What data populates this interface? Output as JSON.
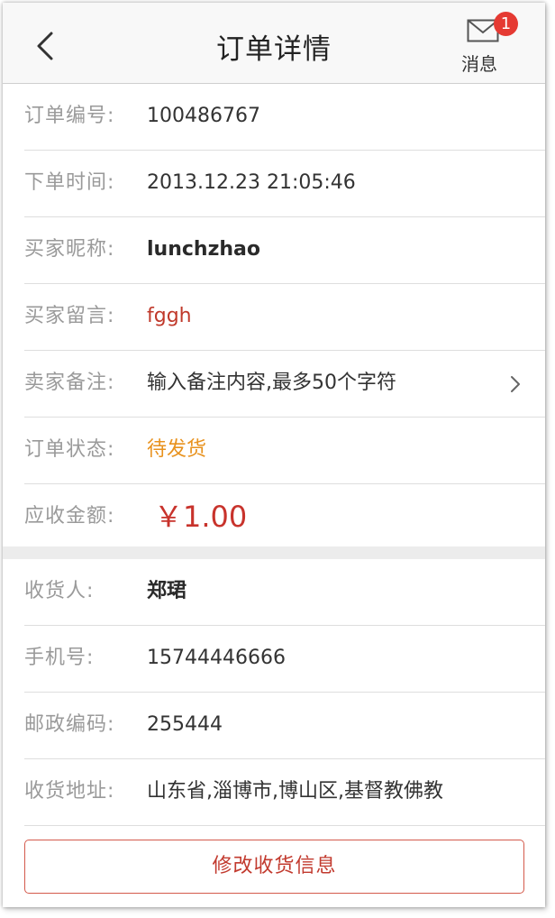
{
  "header": {
    "title": "订单详情",
    "messages_label": "消息",
    "messages_badge": "1"
  },
  "order": {
    "rows": [
      {
        "label": "订单编号:",
        "value": "100486767"
      },
      {
        "label": "下单时间:",
        "value": "2013.12.23 21:05:46"
      },
      {
        "label": "买家昵称:",
        "value": "lunchzhao"
      },
      {
        "label": "买家留言:",
        "value": "fggh"
      },
      {
        "label": "卖家备注:",
        "value": "输入备注内容,最多50个字符"
      },
      {
        "label": "订单状态:",
        "value": "待发货"
      },
      {
        "label": "应收金额:",
        "value": "￥1.00"
      }
    ]
  },
  "shipping": {
    "rows": [
      {
        "label": "收货人:",
        "value": "郑珺"
      },
      {
        "label": "手机号:",
        "value": "15744446666"
      },
      {
        "label": "邮政编码:",
        "value": "255444"
      },
      {
        "label": "收货地址:",
        "value": "山东省,淄博市,博山区,基督教佛教"
      }
    ]
  },
  "actions": {
    "edit_address_label": "修改收货信息"
  },
  "colors": {
    "accent_red": "#c23a2e",
    "status_orange": "#e8921e",
    "badge_red": "#e53a33"
  },
  "icons": {
    "back": "chevron-left-icon",
    "messages": "envelope-icon",
    "remark_more": "chevron-right-icon"
  }
}
